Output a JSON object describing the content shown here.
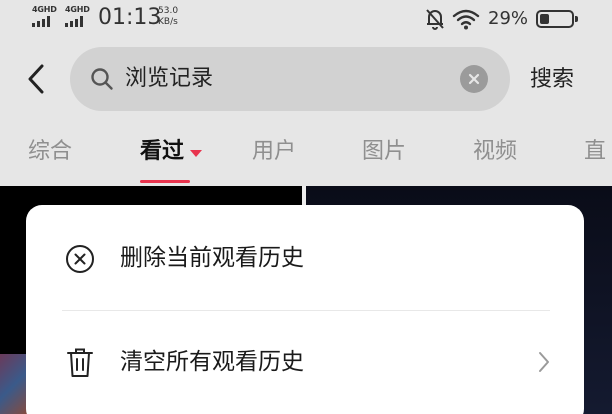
{
  "status_bar": {
    "sim1_generation": "4GHD",
    "sim2_generation": "4GHD",
    "time": "01:13",
    "net_speed_value": "53.0",
    "net_speed_unit": "KB/s",
    "battery_percent": "29%",
    "battery_level": 0.29,
    "icons": [
      "signal-icon",
      "signal-icon",
      "mute-bell-icon",
      "wifi-icon",
      "battery-icon"
    ]
  },
  "search": {
    "back_icon": "back-arrow-icon",
    "search_icon": "magnifier-icon",
    "query": "浏览记录",
    "clear_icon": "clear-x-icon",
    "submit_label": "搜索"
  },
  "tabs": {
    "items": [
      {
        "label": "综合",
        "active": false
      },
      {
        "label": "看过",
        "active": true,
        "has_dropdown": true
      },
      {
        "label": "用户",
        "active": false
      },
      {
        "label": "图片",
        "active": false
      },
      {
        "label": "视频",
        "active": false
      },
      {
        "label": "直",
        "active": false
      }
    ],
    "accent_color": "#e8344e"
  },
  "sheet": {
    "items": [
      {
        "label": "删除当前观看历史",
        "icon": "circle-x-icon",
        "has_chevron": false
      },
      {
        "label": "清空所有观看历史",
        "icon": "trash-icon",
        "has_chevron": true
      }
    ]
  },
  "colors": {
    "overlay_bg": "#e6e6e6",
    "search_box_bg": "#d2d2d2",
    "sheet_bg": "#ffffff",
    "muted_text": "#8f8f8f",
    "accent": "#e8344e"
  }
}
